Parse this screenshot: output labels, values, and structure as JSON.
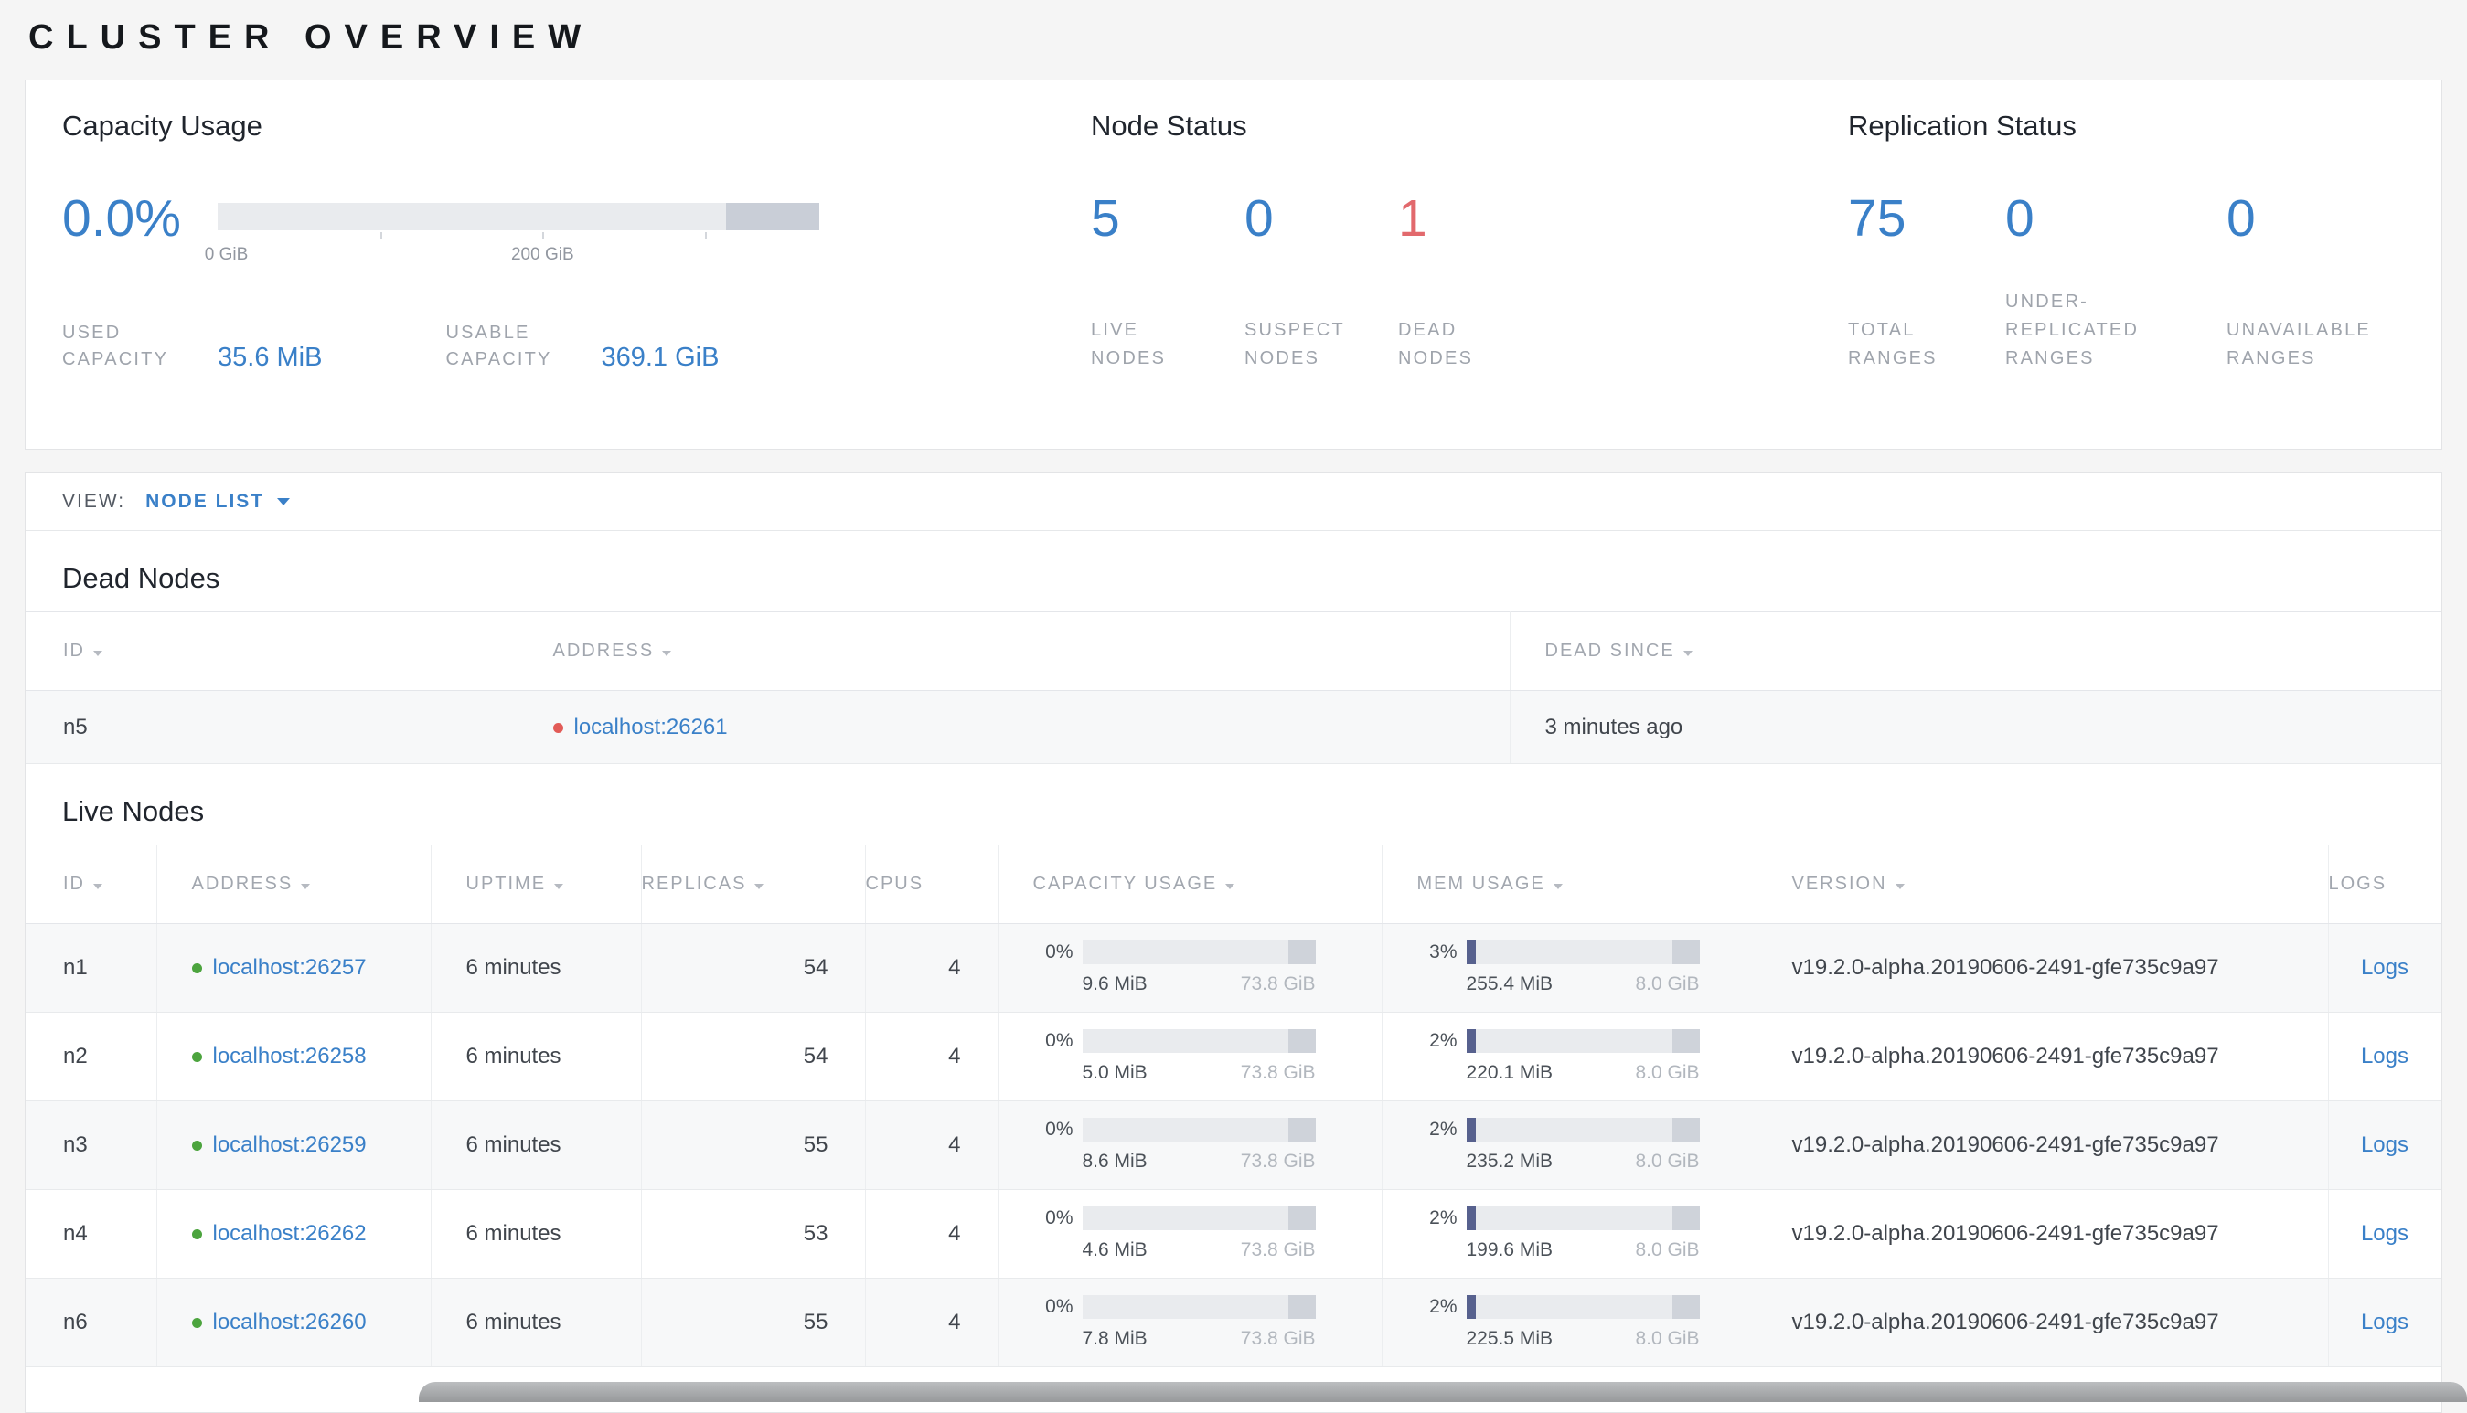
{
  "page_title": "CLUSTER OVERVIEW",
  "summary": {
    "capacity": {
      "heading": "Capacity Usage",
      "percent": "0.0%",
      "axis": {
        "tick0": "0 GiB",
        "tick200": "200 GiB"
      },
      "used": {
        "label": "USED\nCAPACITY",
        "value": "35.6 MiB"
      },
      "usable": {
        "label": "USABLE\nCAPACITY",
        "value": "369.1 GiB"
      }
    },
    "node_status": {
      "heading": "Node Status",
      "live": {
        "value": "5",
        "label": "LIVE\nNODES"
      },
      "suspect": {
        "value": "0",
        "label": "SUSPECT\nNODES"
      },
      "dead": {
        "value": "1",
        "label": "DEAD\nNODES"
      }
    },
    "replication": {
      "heading": "Replication Status",
      "total": {
        "value": "75",
        "label": "TOTAL\nRANGES"
      },
      "under_replicated": {
        "value": "0",
        "label": "UNDER-\nREPLICATED\nRANGES"
      },
      "unavailable": {
        "value": "0",
        "label": "UNAVAILABLE\nRANGES"
      }
    }
  },
  "view_bar": {
    "label": "VIEW:",
    "selected": "NODE LIST"
  },
  "dead_nodes": {
    "heading": "Dead Nodes",
    "headers": {
      "id": "ID",
      "address": "ADDRESS",
      "dead_since": "DEAD SINCE"
    },
    "rows": [
      {
        "id": "n5",
        "address": "localhost:26261",
        "dead_since": "3 minutes ago"
      }
    ]
  },
  "live_nodes": {
    "heading": "Live Nodes",
    "headers": {
      "id": "ID",
      "address": "ADDRESS",
      "uptime": "UPTIME",
      "replicas": "REPLICAS",
      "cpus": "CPUS",
      "capacity": "CAPACITY USAGE",
      "mem": "MEM USAGE",
      "version": "VERSION",
      "logs": "LOGS"
    },
    "logs_label": "Logs",
    "rows": [
      {
        "id": "n1",
        "address": "localhost:26257",
        "uptime": "6 minutes",
        "replicas": "54",
        "cpus": "4",
        "capacity": {
          "pct": 0,
          "pct_label": "0%",
          "used": "9.6 MiB",
          "total": "73.8 GiB"
        },
        "mem": {
          "pct": 3,
          "pct_label": "3%",
          "used": "255.4 MiB",
          "total": "8.0 GiB"
        },
        "version": "v19.2.0-alpha.20190606-2491-gfe735c9a97"
      },
      {
        "id": "n2",
        "address": "localhost:26258",
        "uptime": "6 minutes",
        "replicas": "54",
        "cpus": "4",
        "capacity": {
          "pct": 0,
          "pct_label": "0%",
          "used": "5.0 MiB",
          "total": "73.8 GiB"
        },
        "mem": {
          "pct": 2,
          "pct_label": "2%",
          "used": "220.1 MiB",
          "total": "8.0 GiB"
        },
        "version": "v19.2.0-alpha.20190606-2491-gfe735c9a97"
      },
      {
        "id": "n3",
        "address": "localhost:26259",
        "uptime": "6 minutes",
        "replicas": "55",
        "cpus": "4",
        "capacity": {
          "pct": 0,
          "pct_label": "0%",
          "used": "8.6 MiB",
          "total": "73.8 GiB"
        },
        "mem": {
          "pct": 2,
          "pct_label": "2%",
          "used": "235.2 MiB",
          "total": "8.0 GiB"
        },
        "version": "v19.2.0-alpha.20190606-2491-gfe735c9a97"
      },
      {
        "id": "n4",
        "address": "localhost:26262",
        "uptime": "6 minutes",
        "replicas": "53",
        "cpus": "4",
        "capacity": {
          "pct": 0,
          "pct_label": "0%",
          "used": "4.6 MiB",
          "total": "73.8 GiB"
        },
        "mem": {
          "pct": 2,
          "pct_label": "2%",
          "used": "199.6 MiB",
          "total": "8.0 GiB"
        },
        "version": "v19.2.0-alpha.20190606-2491-gfe735c9a97"
      },
      {
        "id": "n6",
        "address": "localhost:26260",
        "uptime": "6 minutes",
        "replicas": "55",
        "cpus": "4",
        "capacity": {
          "pct": 0,
          "pct_label": "0%",
          "used": "7.8 MiB",
          "total": "73.8 GiB"
        },
        "mem": {
          "pct": 2,
          "pct_label": "2%",
          "used": "225.5 MiB",
          "total": "8.0 GiB"
        },
        "version": "v19.2.0-alpha.20190606-2491-gfe735c9a97"
      }
    ]
  },
  "colors": {
    "accent_blue": "#3a80c8",
    "alert_red": "#e2696d",
    "live_green": "#4ca43e",
    "dead_red": "#e25b57",
    "bar_used_fill": "#57618e"
  }
}
